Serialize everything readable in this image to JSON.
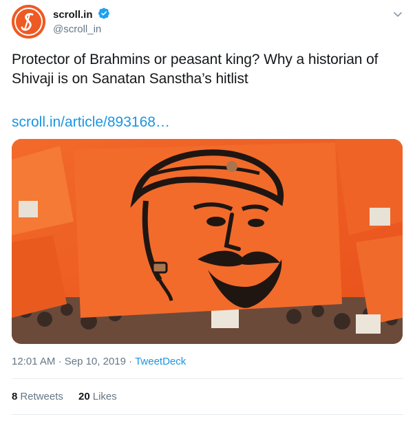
{
  "account": {
    "display_name": "scroll.in",
    "handle": "@scroll_in",
    "avatar_letter": "S",
    "brand_color": "#ee5a24",
    "verified_color": "#1da1f2"
  },
  "tweet": {
    "text": "Protector of Brahmins or peasant king? Why a historian of Shivaji is on Sanatan Sanstha’s hitlist",
    "link_text": "scroll.in/article/893168…",
    "image_description_icon": "card-image"
  },
  "meta": {
    "time": "12:01 AM",
    "separator": "·",
    "date": "Sep 10, 2019",
    "via": "TweetDeck"
  },
  "stats": {
    "retweets_count": "8",
    "retweets_label": "Retweets",
    "likes_count": "20",
    "likes_label": "Likes"
  },
  "colors": {
    "link": "#1b95e0",
    "secondary_text": "#657786",
    "divider": "#e6ecf0"
  }
}
